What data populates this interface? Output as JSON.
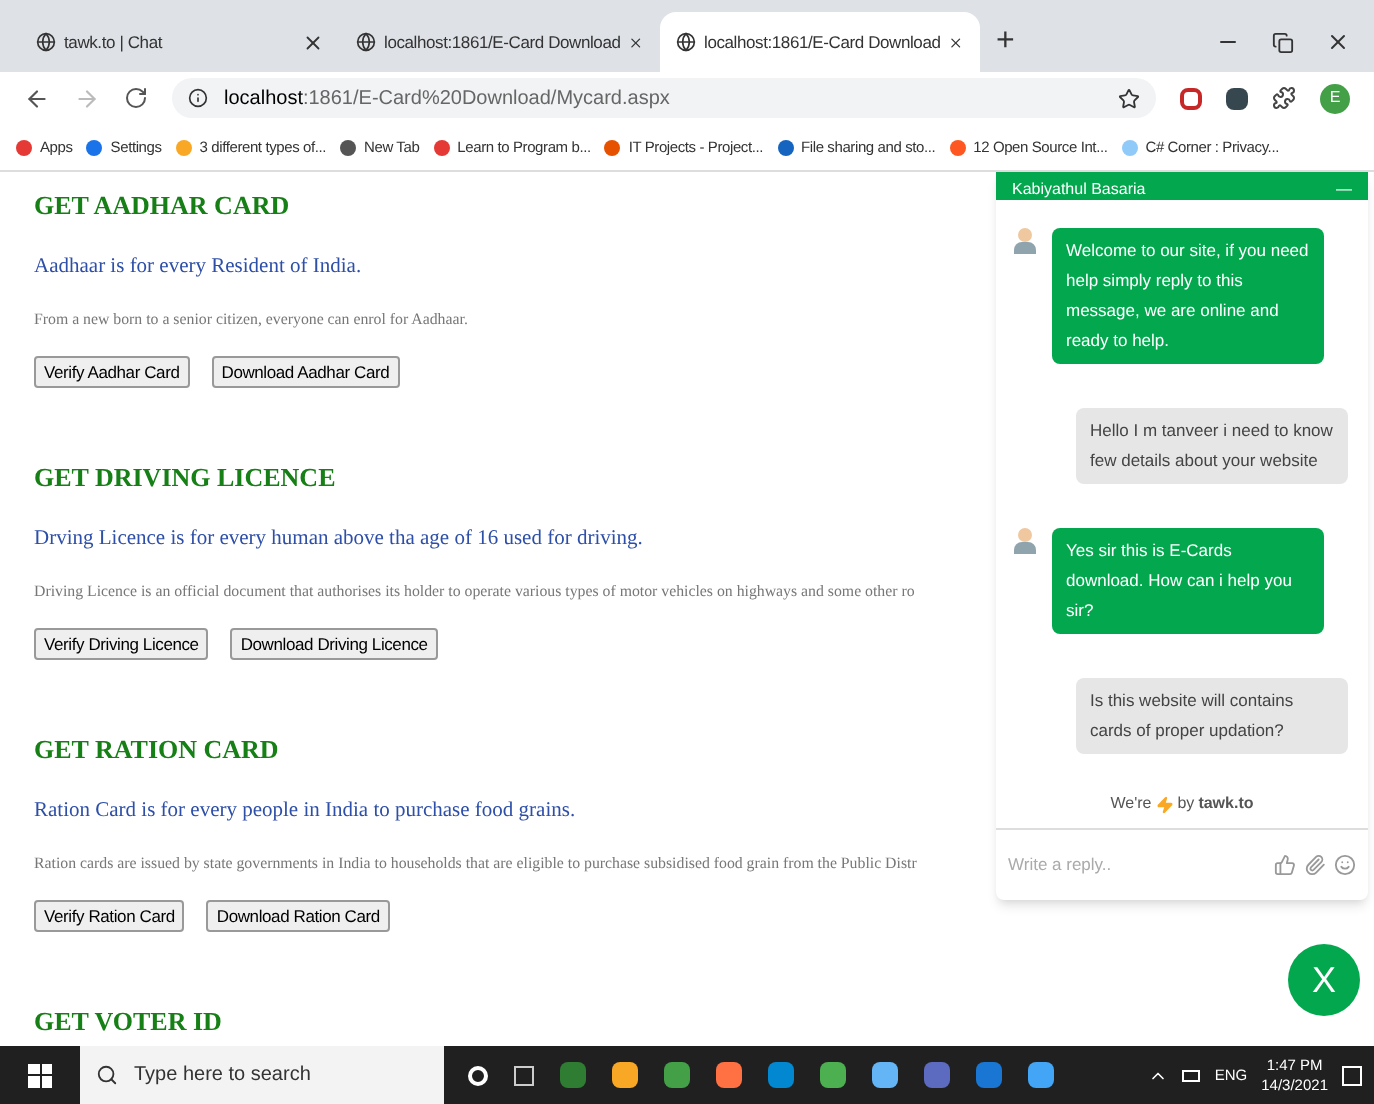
{
  "browser": {
    "tabs": [
      {
        "title": "tawk.to | Chat",
        "selected": false
      },
      {
        "title": "localhost:1861/E-Card Download",
        "selected": false
      },
      {
        "title": "localhost:1861/E-Card Download",
        "selected": true
      }
    ],
    "new_tab": "+",
    "address": {
      "host": "localhost",
      "path": ":1861/E-Card%20Download/Mycard.aspx"
    },
    "profile": "E",
    "bookmarks": [
      "Apps",
      "Settings",
      "3 different types of...",
      "New Tab",
      "Learn to Program b...",
      "IT Projects - Project...",
      "File sharing and sto...",
      "12 Open Source Int...",
      "C# Corner : Privacy..."
    ]
  },
  "sections": [
    {
      "heading": "GET AADHAR CARD",
      "tagline": "Aadhaar is for every Resident of India.",
      "description": "From a new born to a senior citizen, everyone can enrol for Aadhaar.",
      "buttons": [
        "Verify Aadhar Card",
        "Download Aadhar Card"
      ]
    },
    {
      "heading": "GET DRIVING LICENCE",
      "tagline": "Drving Licence is for every human above tha age of 16 used for driving.",
      "description": "Driving Licence is an official document that authorises its holder to operate various types of motor vehicles on highways and some other ro",
      "buttons": [
        "Verify Driving Licence",
        "Download Driving Licence"
      ]
    },
    {
      "heading": "GET RATION CARD",
      "tagline": "Ration Card is for every people in India to purchase food grains.",
      "description": "Ration cards are issued by state governments in India to households that are eligible to purchase subsidised food grain from the Public Distr",
      "buttons": [
        "Verify Ration Card",
        "Download Ration Card"
      ]
    },
    {
      "heading": "GET VOTER ID"
    }
  ],
  "chat": {
    "agent": "Kabiyathul Basaria",
    "minimize": "—",
    "messages": [
      {
        "kind": "agent",
        "text": "Welcome to our site, if you need help simply reply to this message, we are online and ready to help."
      },
      {
        "kind": "visitor",
        "text": "Hello I m tanveer i need to know few details about your website"
      },
      {
        "kind": "agent",
        "text": "Yes sir this is E-Cards download. How can i help you sir?"
      },
      {
        "kind": "visitor",
        "text": "Is this website will contains cards of proper updation?"
      }
    ],
    "branding_prefix": "We're",
    "branding_by": "by",
    "branding_brand": "tawk.to",
    "reply": {
      "placeholder": "Write a reply.."
    },
    "close": "X"
  },
  "taskbar": {
    "search": {
      "placeholder": "Type here to search"
    },
    "language": "ENG",
    "time": "1:47 PM",
    "date": "14/3/2021"
  }
}
